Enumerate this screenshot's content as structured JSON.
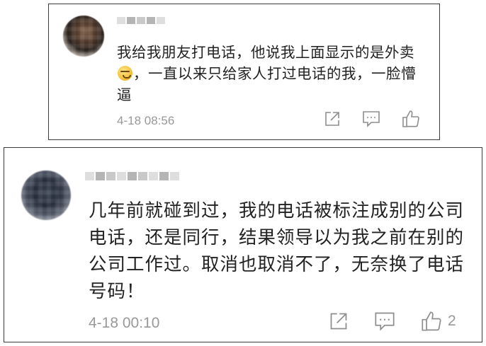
{
  "comments": [
    {
      "user_name": "",
      "text_before_emoji": "我给我朋友打电话，他说我上面显示的是外卖",
      "emoji": "grimace-emoji",
      "text_after_emoji": "，一直以来只给家人打过电话的我，一脸懵逼",
      "timestamp": "4-18 08:56",
      "like_count": ""
    },
    {
      "user_name": "",
      "text": "几年前就碰到过，我的电话被标注成别的公司电话，还是同行，结果领导以为我之前在别的公司工作过。取消也取消不了，无奈换了电话号码！",
      "timestamp": "4-18 00:10",
      "like_count": "2"
    }
  ],
  "icons": {
    "share": "share-icon",
    "comment": "comment-icon",
    "like": "thumbs-up-icon"
  },
  "colors": {
    "text": "#222222",
    "meta": "#999999",
    "border": "#3a3a3a"
  }
}
